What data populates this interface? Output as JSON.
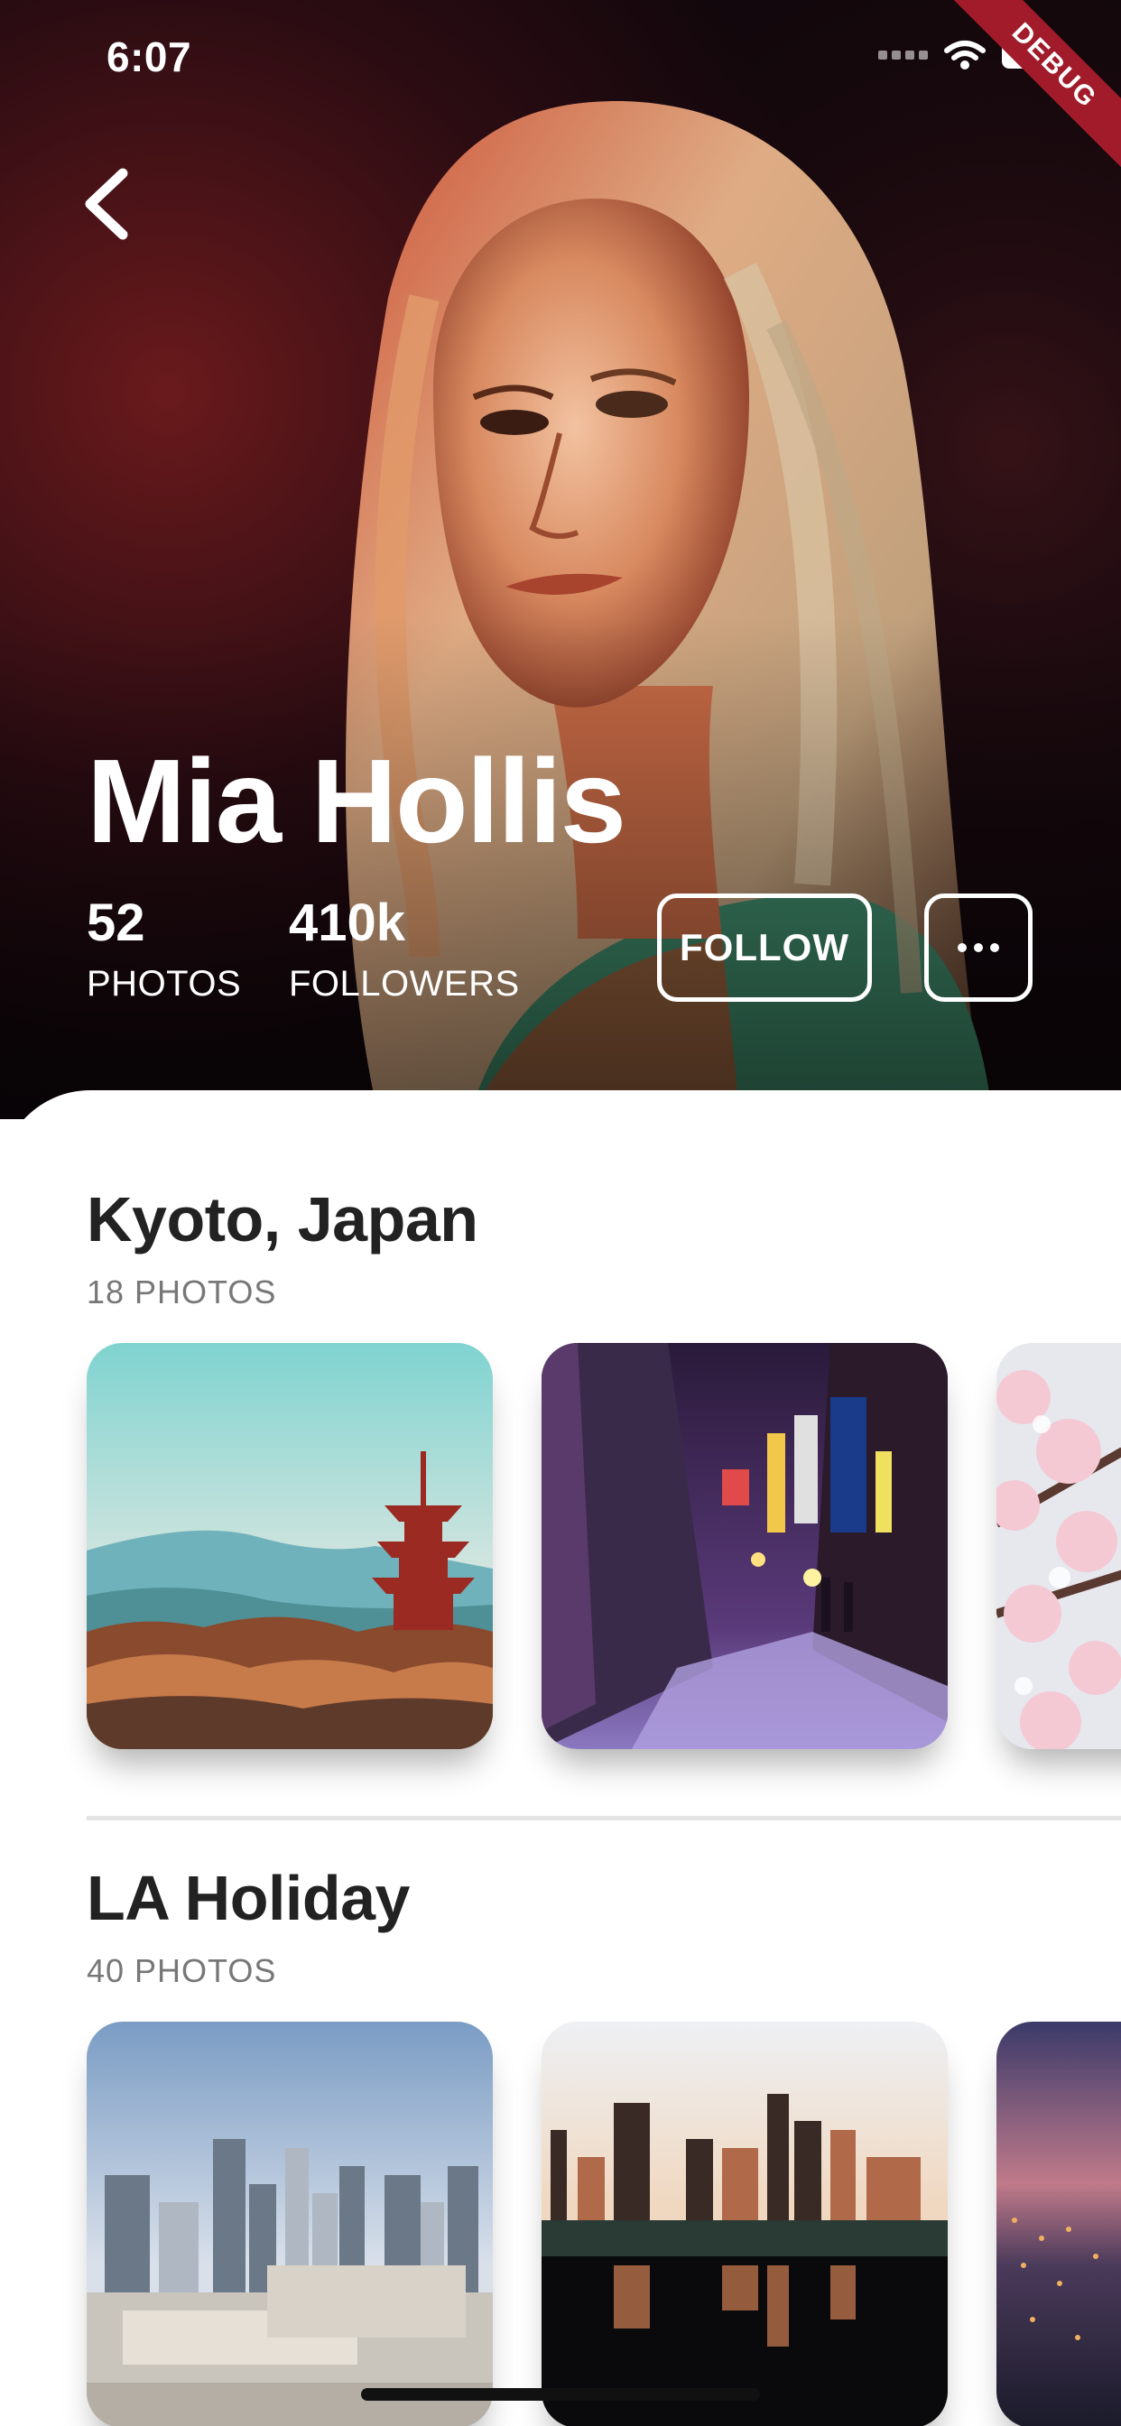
{
  "status_bar": {
    "time": "6:07",
    "icons": [
      "cellular-signal-icon",
      "wifi-icon",
      "battery-icon"
    ],
    "debug_banner": "DEBUG"
  },
  "header": {
    "back_icon": "chevron-left-icon"
  },
  "profile": {
    "name": "Mia Hollis",
    "stats": [
      {
        "value": "52",
        "label": "PHOTOS"
      },
      {
        "value": "410k",
        "label": "FOLLOWERS"
      }
    ],
    "follow_label": "FOLLOW",
    "more_icon": "more-horizontal-icon"
  },
  "albums": [
    {
      "title": "Kyoto, Japan",
      "count": "18 PHOTOS",
      "photos": [
        "kyoto-pagoda-landscape",
        "neon-alley-night",
        "cherry-blossoms"
      ]
    },
    {
      "title": "LA Holiday",
      "count": "40 PHOTOS",
      "photos": [
        "city-skyline-day",
        "skyline-reflection-sunset",
        "city-dusk-lights"
      ]
    }
  ],
  "colors": {
    "accent_text": "#222222",
    "muted_text": "#777777",
    "divider": "#e4e4e4",
    "debug_banner": "#a11b2a"
  }
}
